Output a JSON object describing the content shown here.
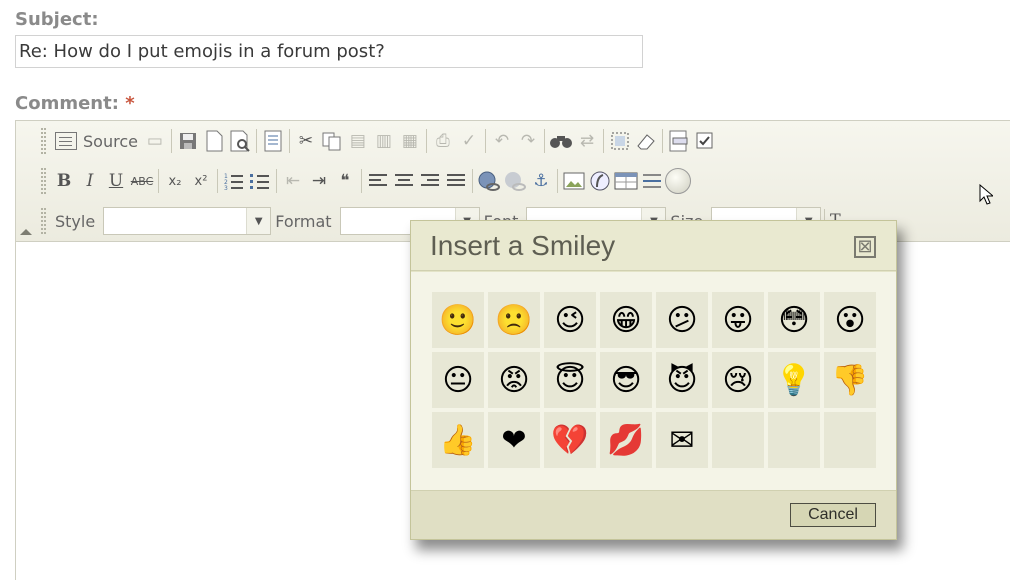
{
  "subject": {
    "label": "Subject:",
    "value": "Re: How do I put emojis in a forum post?"
  },
  "comment": {
    "label": "Comment:",
    "required_mark": "*"
  },
  "toolbar": {
    "source_label": "Source",
    "style_label": "Style",
    "format_label": "Format",
    "font_label": "Font",
    "size_label": "Size",
    "row1_icons": [
      "paste-icon",
      "save-icon",
      "new-page-icon",
      "preview-icon",
      "templates-icon",
      "cut-icon",
      "copy-icon",
      "paste-text-icon",
      "paste-word-icon",
      "print-icon",
      "spellcheck-icon",
      "undo-icon",
      "redo-icon",
      "find-icon",
      "replace-icon",
      "select-all-icon",
      "remove-format-icon",
      "form-icon",
      "checkbox-icon"
    ],
    "row2_icons": [
      "bold-icon",
      "italic-icon",
      "underline-icon",
      "strike-icon",
      "subscript-icon",
      "superscript-icon",
      "numbered-list-icon",
      "bulleted-list-icon",
      "outdent-icon",
      "indent-icon",
      "blockquote-icon",
      "align-left-icon",
      "align-center-icon",
      "align-right-icon",
      "justify-icon",
      "link-icon",
      "unlink-icon",
      "anchor-icon",
      "image-icon",
      "flash-icon",
      "table-icon",
      "horizontal-rule-icon",
      "smiley-icon"
    ],
    "glyphs": {
      "bold": "B",
      "italic": "I",
      "underline": "U",
      "strike": "ABC",
      "subscript": "x₂",
      "superscript": "x²",
      "blockquote": "❝",
      "anchor": "⚓",
      "cut": "✂",
      "undo": "↶",
      "redo": "↷",
      "find": "🔭"
    }
  },
  "dialog": {
    "title": "Insert a Smiley",
    "close_glyph": "⊠",
    "cancel_label": "Cancel",
    "smileys": [
      {
        "name": "regular-smile-icon",
        "glyph": "🙂"
      },
      {
        "name": "sad-smile-icon",
        "glyph": "🙁"
      },
      {
        "name": "wink-smile-icon",
        "glyph": "😉"
      },
      {
        "name": "teeth-smile-icon",
        "glyph": "😁"
      },
      {
        "name": "confused-smile-icon",
        "glyph": "😕"
      },
      {
        "name": "tongue-smile-icon",
        "glyph": "😛"
      },
      {
        "name": "embarrassed-smile-icon",
        "glyph": "😳"
      },
      {
        "name": "omg-smile-icon",
        "glyph": "😮"
      },
      {
        "name": "whatchutalkingabout-smile-icon",
        "glyph": "😐"
      },
      {
        "name": "angry-smile-icon",
        "glyph": "😡"
      },
      {
        "name": "angel-smile-icon",
        "glyph": "😇"
      },
      {
        "name": "shades-smile-icon",
        "glyph": "😎"
      },
      {
        "name": "devil-smile-icon",
        "glyph": "😈"
      },
      {
        "name": "cry-smile-icon",
        "glyph": "😢"
      },
      {
        "name": "lightbulb-icon",
        "glyph": "💡"
      },
      {
        "name": "thumbs-down-icon",
        "glyph": "👎"
      },
      {
        "name": "thumbs-up-icon",
        "glyph": "👍"
      },
      {
        "name": "heart-icon",
        "glyph": "❤"
      },
      {
        "name": "broken-heart-icon",
        "glyph": "💔"
      },
      {
        "name": "kiss-icon",
        "glyph": "💋"
      },
      {
        "name": "envelope-icon",
        "glyph": "✉"
      }
    ]
  }
}
